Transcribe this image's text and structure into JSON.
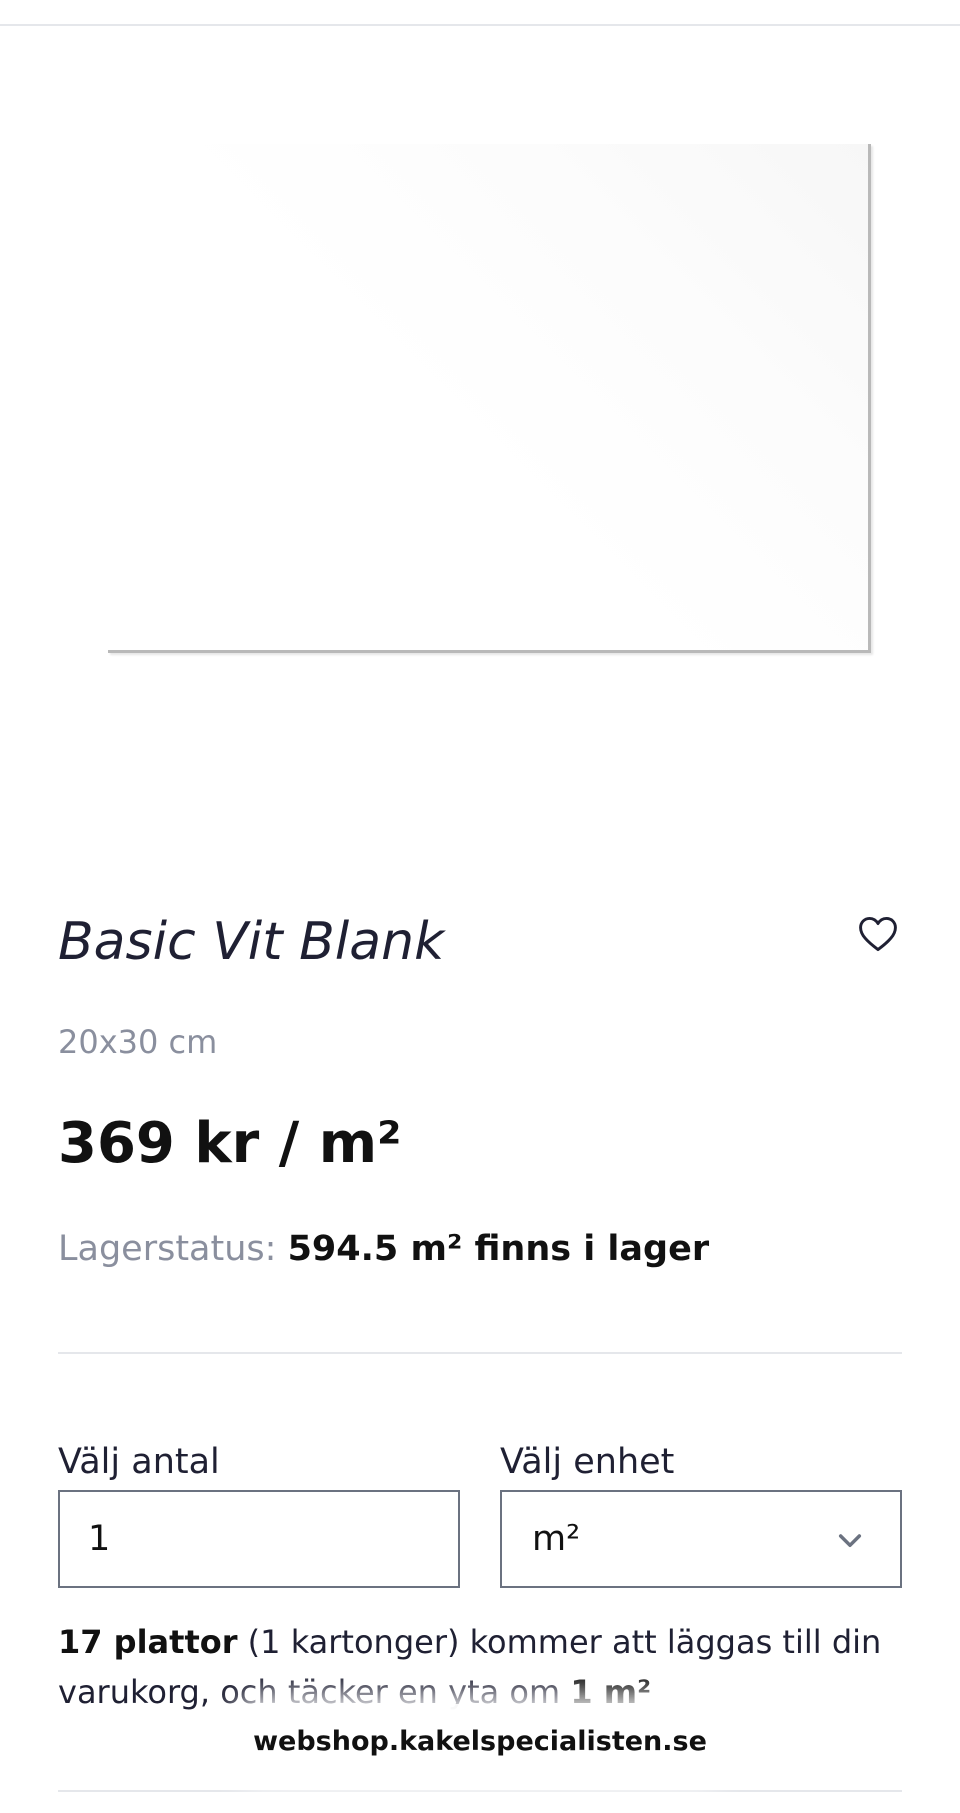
{
  "product": {
    "title": "Basic Vit Blank",
    "size": "20x30 cm",
    "price": "369 kr / m²",
    "favorite_icon": "heart-outline-icon",
    "image_alt": "white-glossy-tile"
  },
  "stock": {
    "label": "Lagerstatus:",
    "value": "594.5 m² finns i lager"
  },
  "quantity": {
    "label": "Välj antal",
    "value": "1"
  },
  "unit": {
    "label": "Välj enhet",
    "selected": "m²",
    "icon": "chevron-down-icon"
  },
  "summary": {
    "tiles": "17 plattor",
    "cartons": "(1 kartonger) kommer att läggas till din varukorg, och täcker en yta om",
    "area": "1 m²"
  },
  "browser": {
    "url": "webshop.kakelspecialisten.se"
  },
  "colors": {
    "text_primary": "#111111",
    "text_muted": "#8a8f9e",
    "border": "#6b7280",
    "divider": "#e5e7eb"
  }
}
